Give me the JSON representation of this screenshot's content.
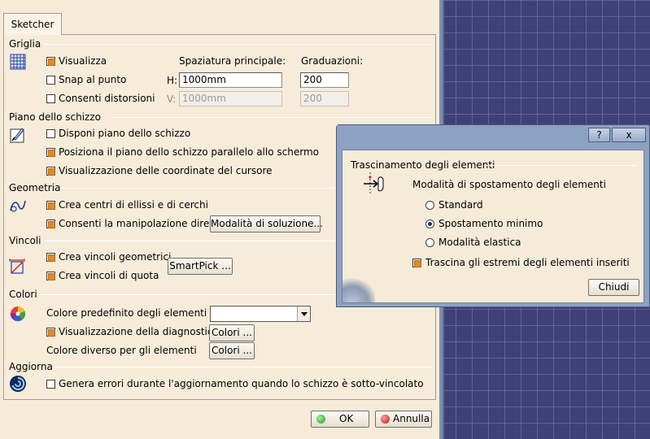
{
  "tab": {
    "label": "Sketcher"
  },
  "griglia": {
    "title": "Griglia",
    "visualizza": "Visualizza",
    "snap": "Snap al punto",
    "distorsioni": "Consenti distorsioni",
    "spaziatura_label": "Spaziatura principale:",
    "graduazioni_label": "Graduazioni:",
    "h_label": "H:",
    "v_label": "V:",
    "h_value": "1000mm",
    "v_value": "1000mm",
    "h_grad": "200",
    "v_grad": "200"
  },
  "piano": {
    "title": "Piano dello schizzo",
    "disponi": "Disponi piano dello schizzo",
    "posiziona": "Posiziona il piano dello schizzo parallelo allo schermo",
    "coordinate": "Visualizzazione delle coordinate del cursore"
  },
  "geometria": {
    "title": "Geometria",
    "centri": "Crea centri di ellissi e di cerchi",
    "manipolazione": "Consenti la manipolazione diretta",
    "modalita_button": "Modalità di soluzione..."
  },
  "vincoli": {
    "title": "Vincoli",
    "geometrici": "Crea vincoli geometrici",
    "quota": "Crea vincoli di quota",
    "smartpick_button": "SmartPick ..."
  },
  "colori": {
    "title": "Colori",
    "predefinito": "Colore predefinito degli elementi",
    "diagnostica": "Visualizzazione della diagnostica",
    "diverso": "Colore diverso per gli elementi",
    "colori_button_1": "Colori ...",
    "colori_button_2": "Colori ..."
  },
  "aggiorna": {
    "title": "Aggiorna",
    "genera": "Genera errori durante l'aggiornamento quando lo schizzo è sotto-vincolato"
  },
  "footer": {
    "ok": "OK",
    "annulla": "Annulla"
  },
  "popup": {
    "help_button": "?",
    "close_button": "x",
    "group_title": "Trascinamento degli elementi",
    "mode_title": "Modalità di spostamento degli elementi",
    "options": [
      "Standard",
      "Spostamento minimo",
      "Modalità elastica"
    ],
    "selected": "Spostamento minimo",
    "trascina": "Trascina gli estremi degli elementi inseriti",
    "chiudi": "Chiudi"
  },
  "colors": {
    "check_fill": "#e08b2c",
    "panel_bg": "#f6ebd8",
    "titlebar": "#8da2c3",
    "background": "#3e4077"
  }
}
